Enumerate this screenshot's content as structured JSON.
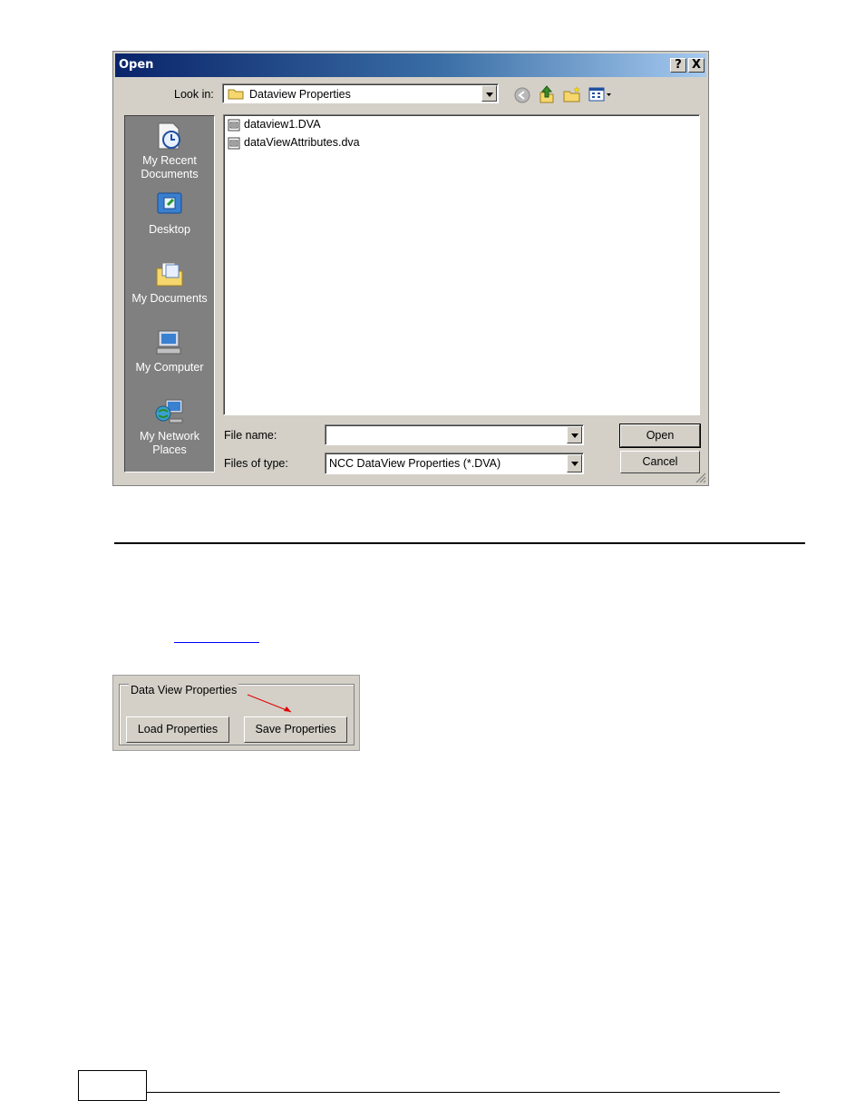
{
  "dialog": {
    "title": "Open",
    "help_button": "?",
    "close_button": "X",
    "look_in_label": "Look in:",
    "look_in_value": "Dataview Properties",
    "toolbar_icons": [
      "back-icon",
      "up-folder-icon",
      "new-folder-icon",
      "views-menu-icon"
    ],
    "places": [
      {
        "label": "My Recent Documents",
        "icon": "recent-documents-icon"
      },
      {
        "label": "Desktop",
        "icon": "desktop-icon"
      },
      {
        "label": "My Documents",
        "icon": "my-documents-icon"
      },
      {
        "label": "My Computer",
        "icon": "my-computer-icon"
      },
      {
        "label": "My Network Places",
        "icon": "network-places-icon"
      }
    ],
    "files": [
      "dataview1.DVA",
      "dataViewAttributes.dva"
    ],
    "file_name_label": "File name:",
    "file_name_value": "",
    "file_type_label": "Files of type:",
    "file_type_value": "NCC DataView Properties (*.DVA)",
    "open_button": "Open",
    "cancel_button": "Cancel"
  },
  "panel": {
    "group_title": "Data View Properties",
    "load_button": "Load Properties",
    "save_button": "Save Properties",
    "annotation_color": "#e00000"
  }
}
